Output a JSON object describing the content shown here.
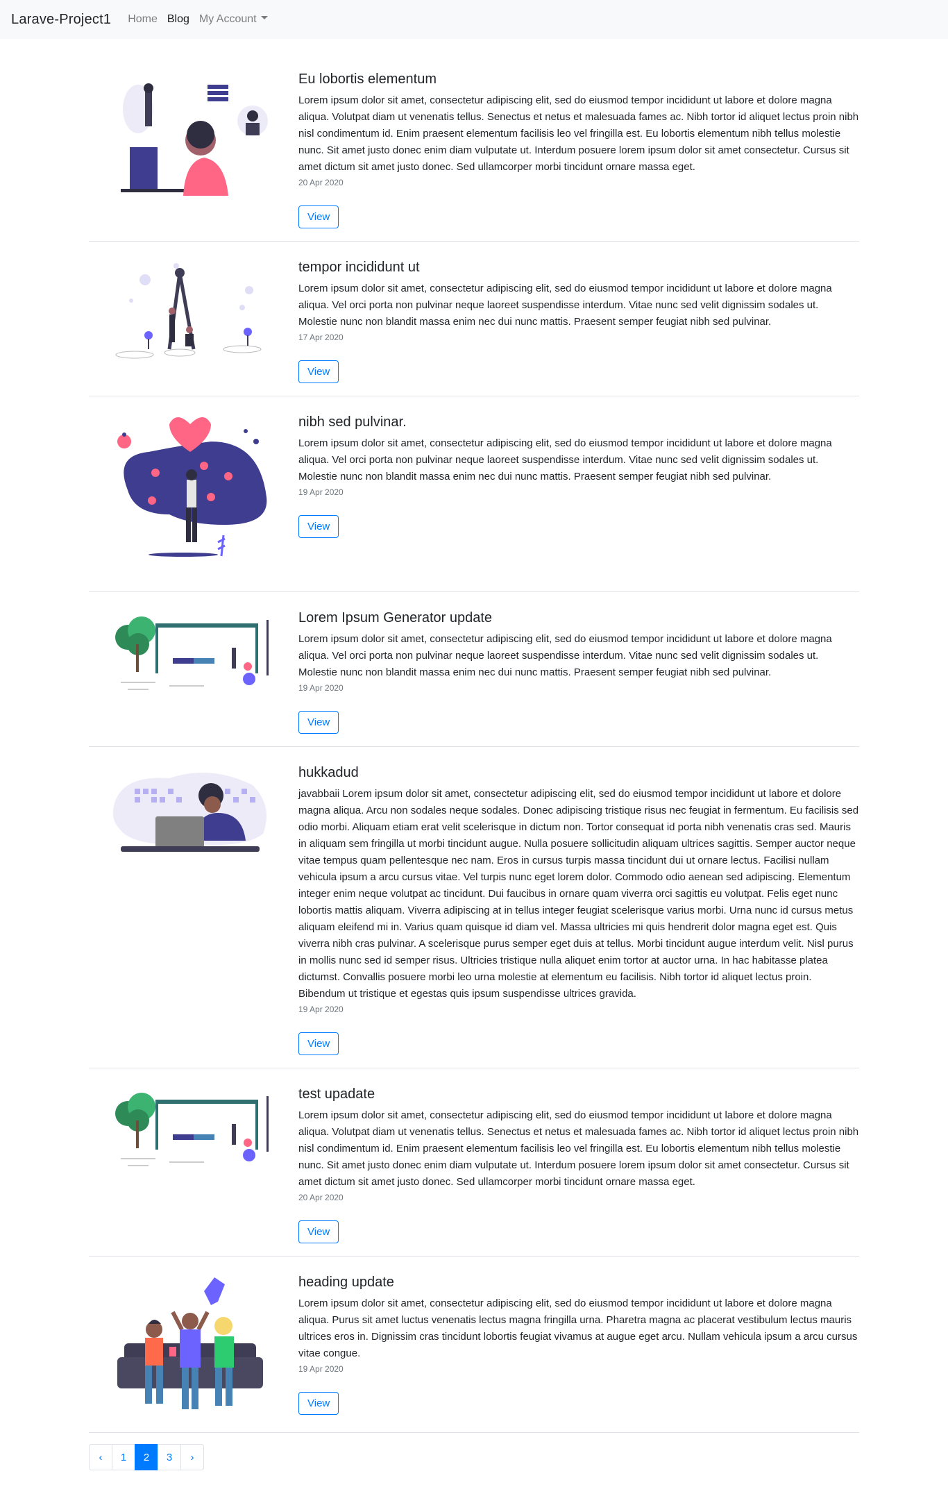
{
  "navbar": {
    "brand": "Larave-Project1",
    "links": [
      "Home",
      "Blog",
      "My Account"
    ]
  },
  "posts": [
    {
      "illustration": "woman-at-computer-illustration",
      "title": "Eu lobortis elementum",
      "body": "Lorem ipsum dolor sit amet, consectetur adipiscing elit, sed do eiusmod tempor incididunt ut labore et dolore magna aliqua. Volutpat diam ut venenatis tellus. Senectus et netus et malesuada fames ac. Nibh tortor id aliquet lectus proin nibh nisl condimentum id. Enim praesent elementum facilisis leo vel fringilla est. Eu lobortis elementum nibh tellus molestie nunc. Sit amet justo donec enim diam vulputate ut. Interdum posuere lorem ipsum dolor sit amet consectetur. Cursus sit amet dictum sit amet justo donec. Sed ullamcorper morbi tincidunt ornare massa eget.",
      "date": "20 Apr 2020",
      "button": "View"
    },
    {
      "illustration": "compass-people-illustration",
      "title": "tempor incididunt ut",
      "body": "Lorem ipsum dolor sit amet, consectetur adipiscing elit, sed do eiusmod tempor incididunt ut labore et dolore magna aliqua. Vel orci porta non pulvinar neque laoreet suspendisse interdum. Vitae nunc sed velit dignissim sodales ut. Molestie nunc non blandit massa enim nec dui nunc mattis. Praesent semper feugiat nibh sed pulvinar.",
      "date": "17 Apr 2020",
      "button": "View"
    },
    {
      "illustration": "woman-with-hearts-illustration",
      "title": "nibh sed pulvinar.",
      "body": "Lorem ipsum dolor sit amet, consectetur adipiscing elit, sed do eiusmod tempor incididunt ut labore et dolore magna aliqua. Vel orci porta non pulvinar neque laoreet suspendisse interdum. Vitae nunc sed velit dignissim sodales ut. Molestie nunc non blandit massa enim nec dui nunc mattis. Praesent semper feugiat nibh sed pulvinar.",
      "date": "19 Apr 2020",
      "button": "View"
    },
    {
      "illustration": "bus-stop-illustration",
      "title": "Lorem Ipsum Generator update",
      "body": "Lorem ipsum dolor sit amet, consectetur adipiscing elit, sed do eiusmod tempor incididunt ut labore et dolore magna aliqua. Vel orci porta non pulvinar neque laoreet suspendisse interdum. Vitae nunc sed velit dignissim sodales ut. Molestie nunc non blandit massa enim nec dui nunc mattis. Praesent semper feugiat nibh sed pulvinar.",
      "date": "19 Apr 2020",
      "button": "View"
    },
    {
      "illustration": "man-with-laptop-illustration",
      "title": "hukkadud",
      "body": "javabbaii Lorem ipsum dolor sit amet, consectetur adipiscing elit, sed do eiusmod tempor incididunt ut labore et dolore magna aliqua. Arcu non sodales neque sodales. Donec adipiscing tristique risus nec feugiat in fermentum. Eu facilisis sed odio morbi. Aliquam etiam erat velit scelerisque in dictum non. Tortor consequat id porta nibh venenatis cras sed. Mauris in aliquam sem fringilla ut morbi tincidunt augue. Nulla posuere sollicitudin aliquam ultrices sagittis. Semper auctor neque vitae tempus quam pellentesque nec nam. Eros in cursus turpis massa tincidunt dui ut ornare lectus. Facilisi nullam vehicula ipsum a arcu cursus vitae. Vel turpis nunc eget lorem dolor. Commodo odio aenean sed adipiscing. Elementum integer enim neque volutpat ac tincidunt. Dui faucibus in ornare quam viverra orci sagittis eu volutpat. Felis eget nunc lobortis mattis aliquam. Viverra adipiscing at in tellus integer feugiat scelerisque varius morbi. Urna nunc id cursus metus aliquam eleifend mi in. Varius quam quisque id diam vel. Massa ultricies mi quis hendrerit dolor magna eget est. Quis viverra nibh cras pulvinar. A scelerisque purus semper eget duis at tellus. Morbi tincidunt augue interdum velit. Nisl purus in mollis nunc sed id semper risus. Ultricies tristique nulla aliquet enim tortor at auctor urna. In hac habitasse platea dictumst. Convallis posuere morbi leo urna molestie at elementum eu facilisis. Nibh tortor id aliquet lectus proin. Bibendum ut tristique et egestas quis ipsum suspendisse ultrices gravida.",
      "date": "19 Apr 2020",
      "button": "View"
    },
    {
      "illustration": "bus-stop-illustration",
      "title": "test upadate",
      "body": "Lorem ipsum dolor sit amet, consectetur adipiscing elit, sed do eiusmod tempor incididunt ut labore et dolore magna aliqua. Volutpat diam ut venenatis tellus. Senectus et netus et malesuada fames ac. Nibh tortor id aliquet lectus proin nibh nisl condimentum id. Enim praesent elementum facilisis leo vel fringilla est. Eu lobortis elementum nibh tellus molestie nunc. Sit amet justo donec enim diam vulputate ut. Interdum posuere lorem ipsum dolor sit amet consectetur. Cursus sit amet dictum sit amet justo donec. Sed ullamcorper morbi tincidunt ornare massa eget.",
      "date": "20 Apr 2020",
      "button": "View"
    },
    {
      "illustration": "friends-on-couch-illustration",
      "title": "heading update",
      "body": "Lorem ipsum dolor sit amet, consectetur adipiscing elit, sed do eiusmod tempor incididunt ut labore et dolore magna aliqua. Purus sit amet luctus venenatis lectus magna fringilla urna. Pharetra magna ac placerat vestibulum lectus mauris ultrices eros in. Dignissim cras tincidunt lobortis feugiat vivamus at augue eget arcu. Nullam vehicula ipsum a arcu cursus vitae congue.",
      "date": "19 Apr 2020",
      "button": "View"
    }
  ],
  "pagination": {
    "prev": "‹",
    "pages": [
      "1",
      "2",
      "3"
    ],
    "current": "2",
    "next": "›"
  },
  "colors": {
    "primary": "#007bff",
    "illustration_purple": "#3f3d8f",
    "illustration_accent": "#ff6584"
  }
}
